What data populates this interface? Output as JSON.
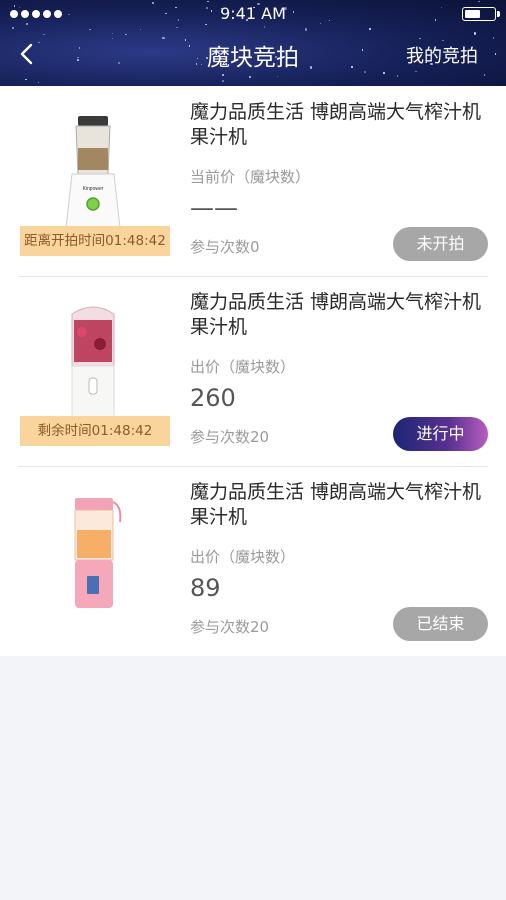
{
  "status_bar": {
    "time": "9:41 AM",
    "battery_level": 0.55
  },
  "nav": {
    "title": "魔块竞拍",
    "right_label": "我的竞拍",
    "back_icon": "chevron-left-icon"
  },
  "items": [
    {
      "title": "魔力品质生活 博朗高端大气榨汁机果汁机",
      "timer": "距离开拍时间01:48:42",
      "price_label": "当前价（魔块数）",
      "price": "——",
      "count": "参与次数0",
      "status": "未开拍",
      "status_color": "#a7a7a7"
    },
    {
      "title": "魔力品质生活 博朗高端大气榨汁机果汁机",
      "timer": "剩余时间01:48:42",
      "price_label": "出价（魔块数）",
      "price": "260",
      "count": "参与次数20",
      "status": "进行中",
      "status_color": "#3a2b86"
    },
    {
      "title": "魔力品质生活 博朗高端大气榨汁机果汁机",
      "price_label": "出价（魔块数）",
      "price": "89",
      "count": "参与次数20",
      "status": "已结束",
      "status_color": "#a7a7a7"
    }
  ]
}
